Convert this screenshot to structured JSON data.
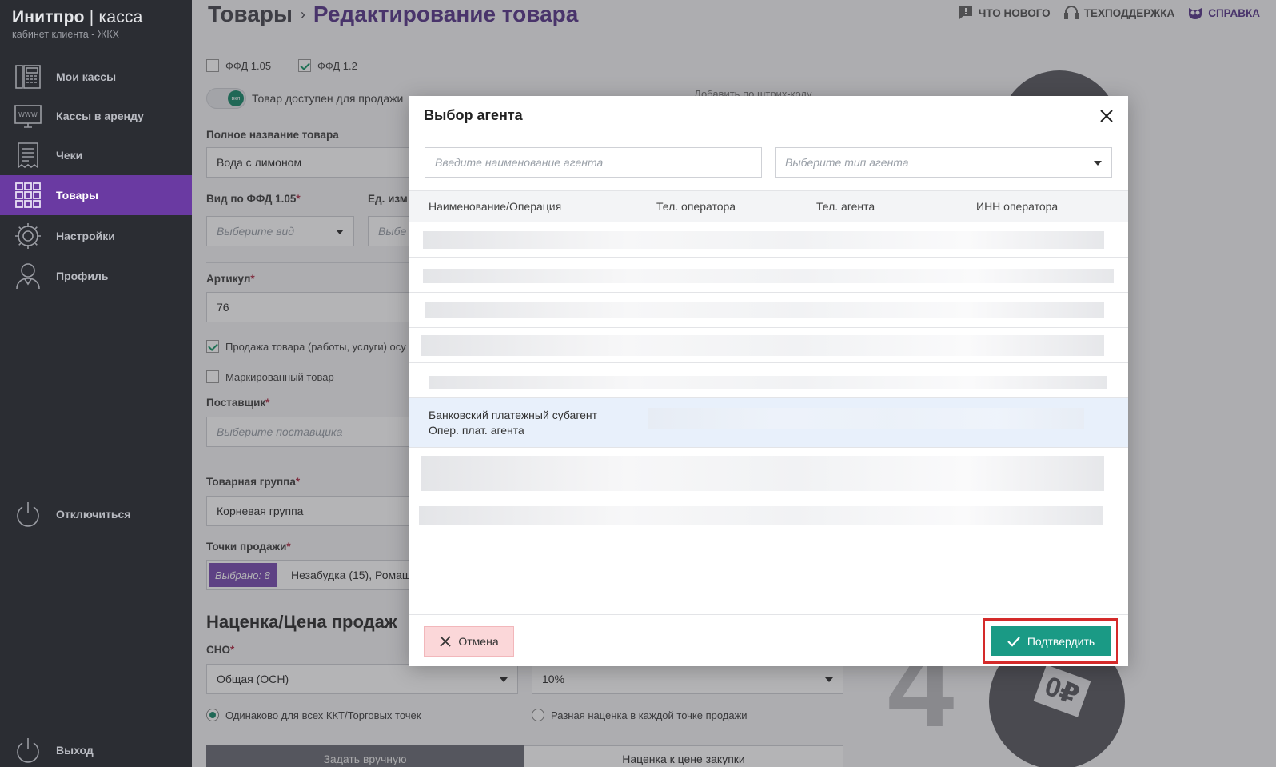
{
  "brand": {
    "name_bold": "Инитпро",
    "name_light": "касса",
    "separator": "|",
    "subtitle": "кабинет клиента - ЖКХ"
  },
  "sidebar": {
    "items": [
      {
        "label": "Мои кассы",
        "icon": "cash-register-icon"
      },
      {
        "label": "Кассы в аренду",
        "icon": "www-monitor-icon"
      },
      {
        "label": "Чеки",
        "icon": "receipt-icon"
      },
      {
        "label": "Товары",
        "icon": "grid-icon",
        "active": true
      },
      {
        "label": "Настройки",
        "icon": "gear-icon"
      },
      {
        "label": "Профиль",
        "icon": "user-icon"
      }
    ],
    "disconnect": "Отключиться",
    "logout": "Выход"
  },
  "header": {
    "breadcrumb_root": "Товары",
    "breadcrumb_sep": "›",
    "breadcrumb_current": "Редактирование товара",
    "links": {
      "whats_new": "ЧТО НОВОГО",
      "support": "ТЕХПОДДЕРЖКА",
      "help": "СПРАВКА"
    }
  },
  "form": {
    "ffd105": "ФФД 1.05",
    "ffd12": "ФФД 1.2",
    "toggle_knob": "вкл",
    "toggle_label": "Товар доступен для продажи",
    "barcode_link": "Добавить по штрих-коду",
    "full_name_label": "Полное название товара",
    "full_name_value": "Вода с лимоном",
    "ffd_kind_label": "Вид по ФФД 1.05",
    "ffd_kind_placeholder": "Выберите вид",
    "unit_label": "Ед. изм",
    "unit_placeholder": "Выбе",
    "article_label": "Артикул",
    "article_value": "76",
    "sale_checkbox": "Продажа товара (работы, услуги) осу",
    "marked_checkbox": "Маркированный товар",
    "supplier_label": "Поставщик",
    "supplier_placeholder": "Выберите поставщика",
    "group_label": "Товарная группа",
    "group_value": "Корневая группа",
    "points_label": "Точки продажи",
    "points_badge": "Выбрано: 8",
    "points_value": "Незабудка (15), Ромаш",
    "markup_title": "Наценка/Цена продаж",
    "sno_label": "СНО",
    "sno_value": "Общая (ОСН)",
    "vat_value": "10%",
    "radio_same": "Одинаково для всех ККТ/Торговых точек",
    "radio_diff": "Разная наценка в каждой точке продажи",
    "tab_manual": "Задать вручную",
    "tab_purchase": "Наценка к цене закупки",
    "required_mark": "*"
  },
  "deco": {
    "number": "4",
    "price_tag": "0₽"
  },
  "modal": {
    "title": "Выбор агента",
    "search_placeholder": "Введите наименование агента",
    "type_placeholder": "Выберите тип агента",
    "columns": [
      "Наименование/Операция",
      "Тел. оператора",
      "Тел. агента",
      "ИНН оператора"
    ],
    "selected_row": {
      "line1": "Банковский платежный субагент",
      "line2": "Опер. плат. агента"
    },
    "cancel": "Отмена",
    "confirm": "Подтвердить"
  },
  "colors": {
    "accent": "#5b3b8c",
    "sidebar_active": "#6a3aa2",
    "confirm": "#1a9a85",
    "cancel_bg": "#fbd7d9",
    "highlight": "#d42a2a"
  }
}
